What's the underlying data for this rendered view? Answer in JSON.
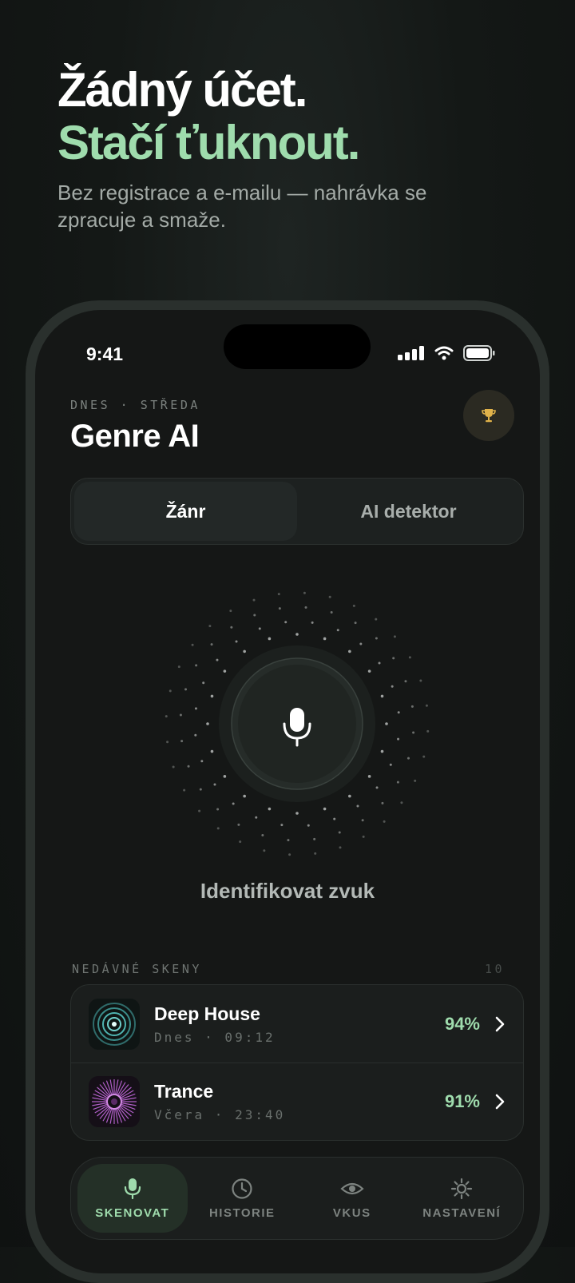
{
  "promo": {
    "headline_line1": "Žádný účet.",
    "headline_line2": "Stačí ťuknout.",
    "subtitle": "Bez registrace a e-mailu — nahrávka se zpracuje a smaže."
  },
  "status_bar": {
    "time": "9:41"
  },
  "header": {
    "dateline": "DNES · STŘEDA",
    "title": "Genre AI",
    "trophy_icon": "trophy-icon"
  },
  "segments": [
    {
      "label": "Žánr",
      "active": true
    },
    {
      "label": "AI detektor",
      "active": false
    }
  ],
  "scanner": {
    "label": "Identifikovat zvuk",
    "icon": "microphone-icon"
  },
  "recent": {
    "title": "NEDÁVNÉ SKENY",
    "count": "10",
    "items": [
      {
        "name": "Deep House",
        "meta": "Dnes · 09:12",
        "confidence": "94%",
        "color": "#4fb3b0"
      },
      {
        "name": "Trance",
        "meta": "Včera · 23:40",
        "confidence": "91%",
        "color": "#b05fc7"
      }
    ]
  },
  "tabs": [
    {
      "label": "SKENOVAT",
      "icon": "microphone-icon",
      "active": true
    },
    {
      "label": "HISTORIE",
      "icon": "clock-icon",
      "active": false
    },
    {
      "label": "VKUS",
      "icon": "eye-icon",
      "active": false
    },
    {
      "label": "NASTAVENÍ",
      "icon": "gear-icon",
      "active": false
    }
  ],
  "colors": {
    "accent": "#9fdcad",
    "trophy": "#e0b24a"
  }
}
